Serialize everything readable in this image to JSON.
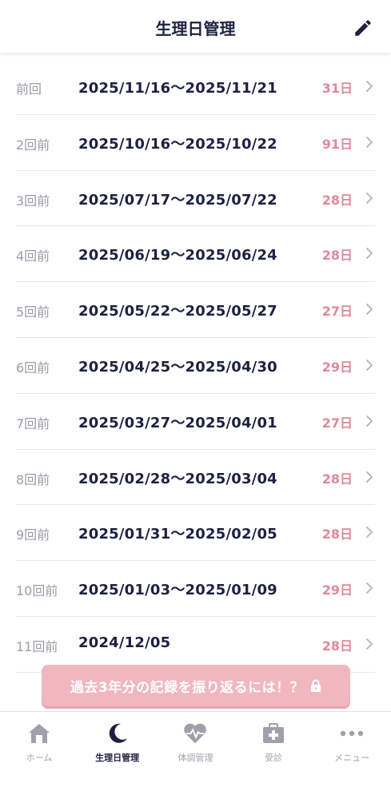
{
  "header": {
    "title": "生理日管理",
    "edit_icon": "pencil-icon"
  },
  "periods": [
    {
      "label": "前回",
      "range": "2025/11/16～2025/11/21",
      "days": "31日"
    },
    {
      "label": "2回前",
      "range": "2025/10/16～2025/10/22",
      "days": "91日"
    },
    {
      "label": "3回前",
      "range": "2025/07/17～2025/07/22",
      "days": "28日"
    },
    {
      "label": "4回前",
      "range": "2025/06/19～2025/06/24",
      "days": "28日"
    },
    {
      "label": "5回前",
      "range": "2025/05/22～2025/05/27",
      "days": "27日"
    },
    {
      "label": "6回前",
      "range": "2025/04/25～2025/04/30",
      "days": "29日"
    },
    {
      "label": "7回前",
      "range": "2025/03/27～2025/04/01",
      "days": "27日"
    },
    {
      "label": "8回前",
      "range": "2025/02/28～2025/03/04",
      "days": "28日"
    },
    {
      "label": "9回前",
      "range": "2025/01/31～2025/02/05",
      "days": "28日"
    },
    {
      "label": "10回前",
      "range": "2025/01/03～2025/01/09",
      "days": "29日"
    },
    {
      "label": "11回前",
      "range": "2024/12/05",
      "days": "28日"
    }
  ],
  "cta": {
    "label": "過去3年分の記録を振り返るには！？",
    "icon": "lock-icon"
  },
  "tabs": [
    {
      "label": "ホーム",
      "icon": "home-icon",
      "active": false
    },
    {
      "label": "生理日管理",
      "icon": "moon-icon",
      "active": true
    },
    {
      "label": "体調管理",
      "icon": "heart-pulse-icon",
      "active": false
    },
    {
      "label": "受診",
      "icon": "medical-cross-icon",
      "active": false
    },
    {
      "label": "メニュー",
      "icon": "more-dots-icon",
      "active": false
    }
  ],
  "colors": {
    "text_dark": "#1d2140",
    "label_gray": "#9b9ca6",
    "days_pink": "#e0889a",
    "cta_pink": "#f1b7bf",
    "tab_inactive": "#a2a3ab"
  }
}
